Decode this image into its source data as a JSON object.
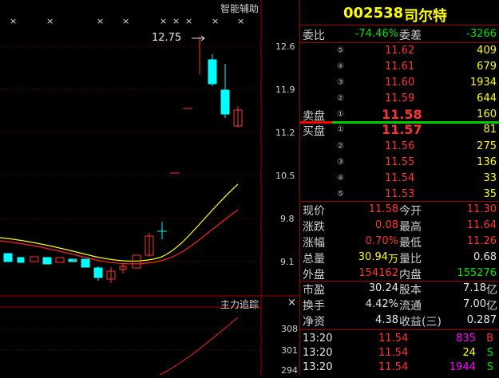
{
  "chart": {
    "indicator_label": "智能辅助",
    "high_marker": "12.75",
    "price_axis": [
      "12.6",
      "11.9",
      "11.2",
      "10.5",
      "9.8",
      "9.1"
    ],
    "sub_title": "主力追踪",
    "sub_axis": [
      "308",
      "301",
      "294"
    ],
    "close_icon": "close-icon",
    "x_marks": [
      "×",
      "×",
      "×",
      "×",
      "×",
      "×",
      "×",
      "×",
      "×"
    ]
  },
  "stock": {
    "code": "002538",
    "name": "司尔特"
  },
  "weibi": {
    "label1": "委比",
    "value1": "-74.46%",
    "label2": "委差",
    "value2": "-3266"
  },
  "sell": [
    {
      "level": "⑤",
      "price": "11.62",
      "vol": "409"
    },
    {
      "level": "④",
      "price": "11.61",
      "vol": "679"
    },
    {
      "level": "③",
      "price": "11.60",
      "vol": "1934"
    },
    {
      "level": "②",
      "price": "11.59",
      "vol": "644"
    },
    {
      "level": "①",
      "price": "11.58",
      "vol": "160",
      "label": "卖盘"
    }
  ],
  "buy": [
    {
      "level": "①",
      "price": "11.57",
      "vol": "81",
      "label": "买盘"
    },
    {
      "level": "②",
      "price": "11.56",
      "vol": "275"
    },
    {
      "level": "③",
      "price": "11.55",
      "vol": "136"
    },
    {
      "level": "④",
      "price": "11.54",
      "vol": "33"
    },
    {
      "level": "⑤",
      "price": "11.53",
      "vol": "35"
    }
  ],
  "quote": [
    {
      "l1": "现价",
      "v1": "11.58",
      "l2": "今开",
      "v2": "11.30"
    },
    {
      "l1": "涨跌",
      "v1": "0.08",
      "l2": "最高",
      "v2": "11.64"
    },
    {
      "l1": "涨幅",
      "v1": "0.70%",
      "l2": "最低",
      "v2": "11.26"
    },
    {
      "l1": "总量",
      "v1": "30.94",
      "v1u": "万",
      "l2": "量比",
      "v2": "0.68"
    },
    {
      "l1": "外盘",
      "v1": "154162",
      "l2": "内盘",
      "v2": "155276"
    }
  ],
  "fund": [
    {
      "l1": "市盈",
      "v1": "30.24",
      "l2": "股本",
      "v2": "7.18",
      "u2": "亿"
    },
    {
      "l1": "换手",
      "v1": "4.42%",
      "l2": "流通",
      "v2": "7.00",
      "u2": "亿"
    },
    {
      "l1": "净资",
      "v1": "4.38",
      "l2": "收益(三)",
      "v2": "0.287"
    }
  ],
  "ticks": [
    {
      "time": "13:20",
      "price": "11.54",
      "vol": "835",
      "side": "B"
    },
    {
      "time": "13:20",
      "price": "11.54",
      "vol": "24",
      "side": "S"
    },
    {
      "time": "13:20",
      "price": "11.54",
      "vol": "1944",
      "side": "S"
    }
  ]
}
